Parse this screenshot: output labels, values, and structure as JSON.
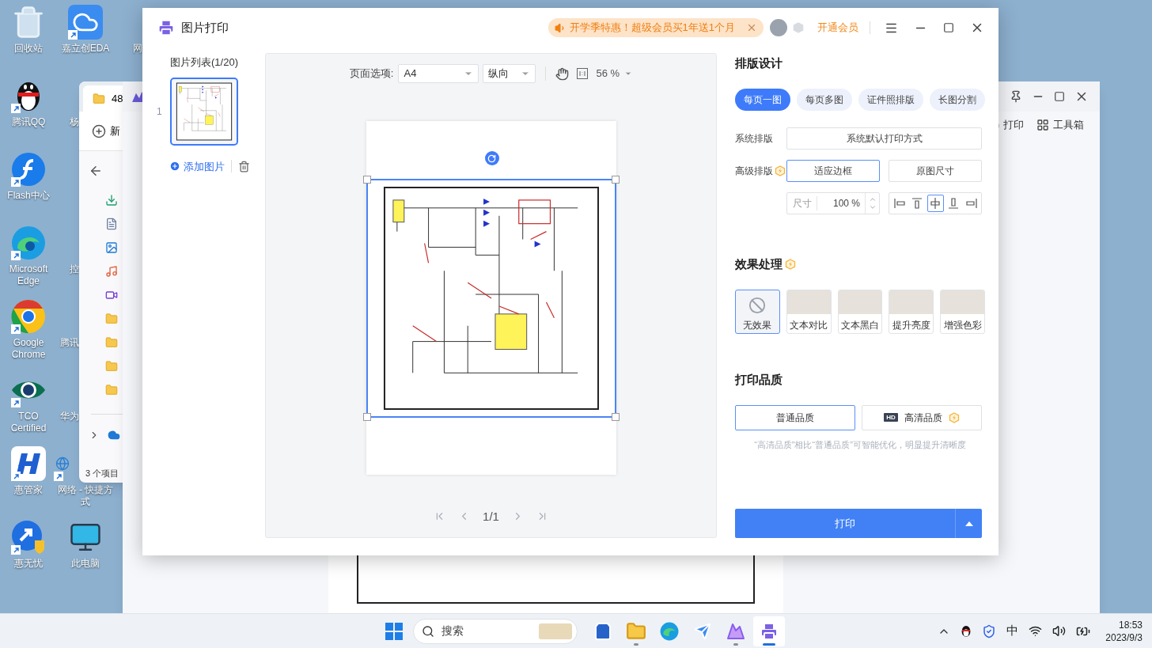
{
  "desktop": {
    "columns": [
      [
        {
          "label": "回收站",
          "kind": "recycle"
        },
        {
          "label": "腾讯QQ",
          "kind": "penguin"
        },
        {
          "label": "Flash中心",
          "kind": "flash"
        },
        {
          "label": "Microsoft Edge",
          "kind": "edge"
        },
        {
          "label": "Google Chrome",
          "kind": "chrome"
        },
        {
          "label": "TCO Certified",
          "kind": "eye"
        },
        {
          "label": "惠管家",
          "kind": "hlogo"
        },
        {
          "label": "惠无忧",
          "kind": "shieldlogo"
        }
      ],
      [
        {
          "label": "嘉立创EDA",
          "kind": "cloud"
        },
        {
          "label": "杨"
        },
        null,
        {
          "label": "控"
        },
        {
          "label": "腾讯"
        },
        {
          "label": "华为"
        },
        {
          "label": "网络 - 快捷方式",
          "kind": "globe"
        },
        {
          "label": "此电脑",
          "kind": "monitor"
        }
      ],
      [
        {
          "label": "网"
        }
      ]
    ]
  },
  "explorer_window": {
    "tab_title": "48",
    "new_button": "新",
    "status": "3 个项目"
  },
  "background_window": {
    "toolbar": [
      {
        "label": "打印",
        "kind": "print"
      },
      {
        "label": "工具箱",
        "kind": "tools"
      }
    ]
  },
  "dialog": {
    "title": "图片打印",
    "promo": "开学季特惠！超级会员买1年送1个月",
    "vip_link": "开通会员",
    "image_list": {
      "title": "图片列表(1/20)",
      "items": [
        {
          "index": "1",
          "selected": true
        }
      ],
      "add_button": "添加图片"
    },
    "preview": {
      "page_options_label": "页面选项:",
      "paper": "A4",
      "orientation": "纵向",
      "zoom": "56 %",
      "pager": "1/1"
    },
    "layout": {
      "title": "排版设计",
      "tabs": [
        {
          "label": "每页一图",
          "selected": true
        },
        {
          "label": "每页多图",
          "selected": false
        },
        {
          "label": "证件照排版",
          "selected": false
        },
        {
          "label": "长图分割",
          "selected": false
        }
      ],
      "system_label": "系统排版",
      "system_value": "系统默认打印方式",
      "advanced_label": "高级排版",
      "advanced_options": [
        {
          "label": "适应边框",
          "selected": true
        },
        {
          "label": "原图尺寸",
          "selected": false
        }
      ],
      "size_label": "尺寸",
      "size_value": "100 %",
      "alignments": [
        {
          "kind": "left",
          "selected": false
        },
        {
          "kind": "top",
          "selected": false
        },
        {
          "kind": "center",
          "selected": true
        },
        {
          "kind": "bottom",
          "selected": false
        },
        {
          "kind": "right",
          "selected": false
        }
      ]
    },
    "effects": {
      "title": "效果处理",
      "items": [
        {
          "label": "无效果",
          "kind": "none",
          "selected": true
        },
        {
          "label": "文本对比",
          "kind": "photo",
          "selected": false
        },
        {
          "label": "文本黑白",
          "kind": "photo",
          "selected": false
        },
        {
          "label": "提升亮度",
          "kind": "photo",
          "selected": false
        },
        {
          "label": "增强色彩",
          "kind": "photo",
          "selected": false
        }
      ]
    },
    "quality": {
      "title": "打印品质",
      "options": [
        {
          "label": "普通品质",
          "hd": false,
          "selected": true
        },
        {
          "label": "高清品质",
          "hd": true,
          "selected": false
        }
      ],
      "hd_badge": "HD",
      "hint": "“高清品质”相比“普通品质”可智能优化，明显提升清晰度"
    },
    "print_button": "打印"
  },
  "taskbar": {
    "search_placeholder": "搜索",
    "apps": [
      {
        "kind": "store",
        "open": false,
        "selected": false
      },
      {
        "kind": "explorer",
        "open": true,
        "selected": false
      },
      {
        "kind": "edge",
        "open": false,
        "selected": false
      },
      {
        "kind": "bird",
        "open": false,
        "selected": false
      },
      {
        "kind": "photos",
        "open": true,
        "selected": false
      },
      {
        "kind": "printer",
        "open": true,
        "selected": true
      }
    ],
    "ime": "中",
    "time": "18:53",
    "date": "2023/9/3"
  }
}
